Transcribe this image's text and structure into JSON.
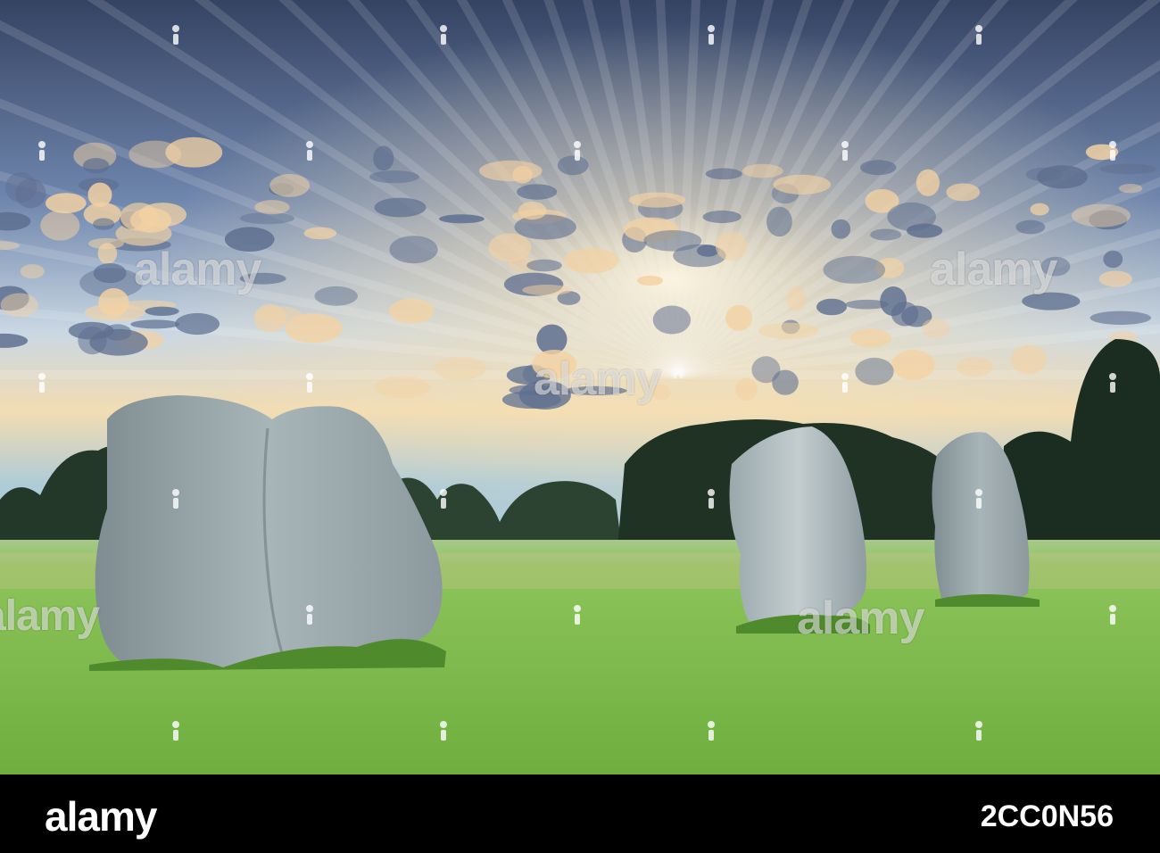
{
  "scene": {
    "subject": "standing-stones-at-sunrise",
    "sky_colors": {
      "top": "#3d4a6b",
      "mid": "#8fa6c8",
      "horizon": "#f4d7a8"
    },
    "grass_color": "#7fbf4d",
    "stone_color": "#9aa7ad",
    "tree_color": "#1e2f22"
  },
  "watermark": {
    "text": "alamy",
    "icon": "alamy-pin-icon"
  },
  "footer": {
    "logo": "alamy",
    "image_id": "2CC0N56"
  }
}
